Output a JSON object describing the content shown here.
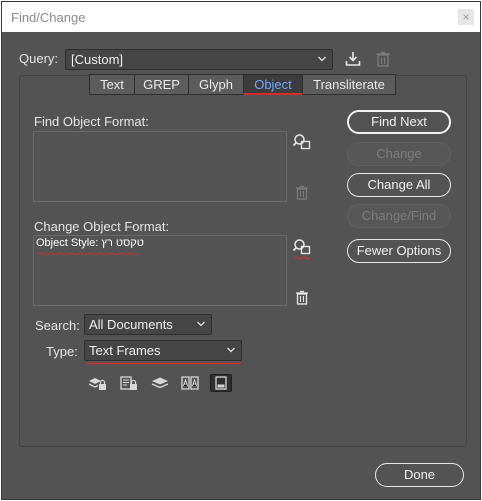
{
  "window": {
    "title": "Find/Change",
    "close_glyph": "×"
  },
  "query": {
    "label": "Query:",
    "value": "[Custom]"
  },
  "tabs": [
    {
      "label": "Text"
    },
    {
      "label": "GREP"
    },
    {
      "label": "Glyph"
    },
    {
      "label": "Object",
      "active": true
    },
    {
      "label": "Transliterate"
    }
  ],
  "find": {
    "label": "Find Object Format:",
    "value": ""
  },
  "change": {
    "label": "Change Object Format:",
    "value": "Object Style: טקסט רץ"
  },
  "buttons": {
    "find_next": "Find Next",
    "change": "Change",
    "change_all": "Change All",
    "change_find": "Change/Find",
    "fewer_options": "Fewer Options",
    "done": "Done"
  },
  "search": {
    "label": "Search:",
    "value": "All Documents"
  },
  "type": {
    "label": "Type:",
    "value": "Text Frames"
  },
  "icons": {
    "save_query": "download-icon",
    "delete_query": "trash-icon",
    "specify_find": "find-format-icon",
    "clear_find": "trash-icon",
    "specify_change": "change-format-icon",
    "clear_change": "trash-icon",
    "options": [
      "locked-layers-icon",
      "locked-stories-icon",
      "hidden-layers-icon",
      "master-pages-icon",
      "footnotes-icon"
    ]
  },
  "colors": {
    "panel_bg": "#535353",
    "active_tab_text": "#6fa9ff",
    "underline_red": "#d82b2b"
  }
}
